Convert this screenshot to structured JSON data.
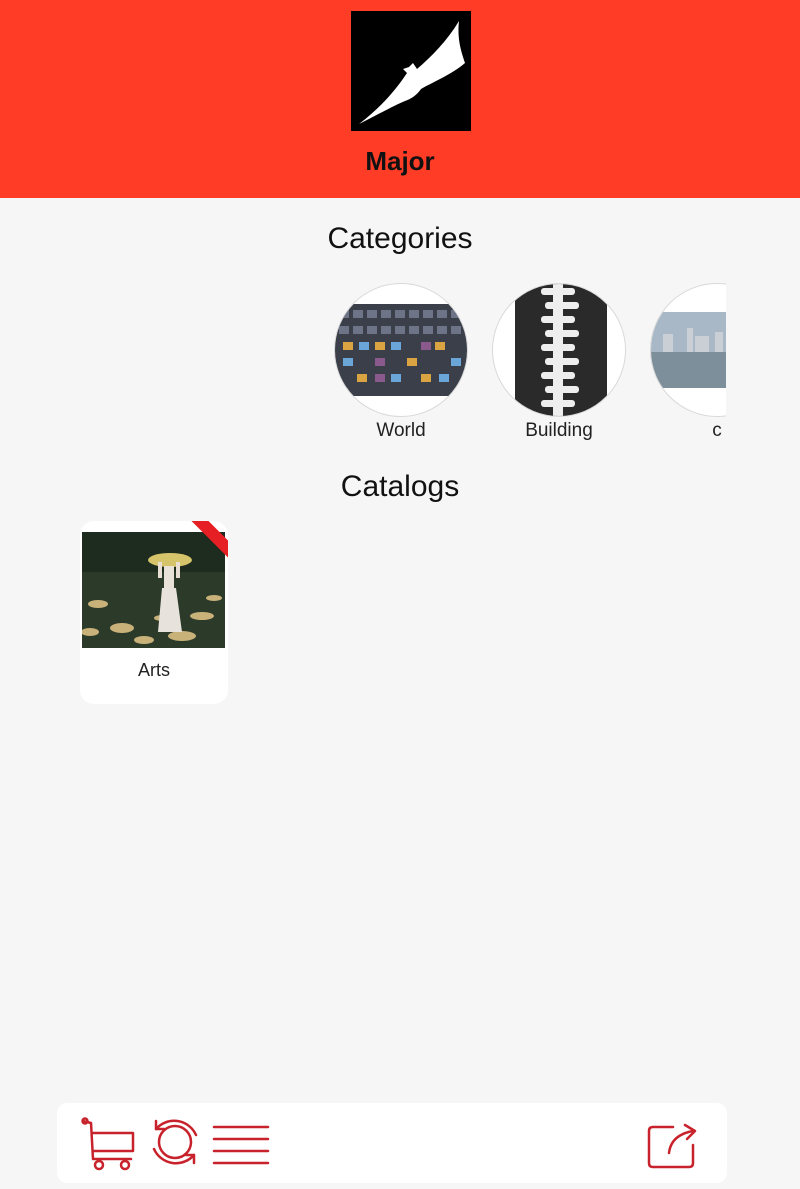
{
  "header": {
    "app_name": "Major",
    "logo_icon": "bat-logo-icon",
    "background_color": "#ff3d27"
  },
  "categories": {
    "title": "Categories",
    "items": [
      {
        "label": "World",
        "icon": "city-buildings-image"
      },
      {
        "label": "Building",
        "icon": "zipper-building-image"
      },
      {
        "label": "c",
        "icon": "city-skyline-image"
      }
    ]
  },
  "catalogs": {
    "title": "Catalogs",
    "items": [
      {
        "label": "Arts",
        "icon": "leaf-girl-image",
        "ribbon_color": "#e51f23"
      }
    ]
  },
  "bottom_bar": {
    "icon_color": "#c8232c",
    "left_icons": [
      "cart-icon",
      "refresh-icon",
      "menu-icon"
    ],
    "right_icons": [
      "share-icon"
    ]
  }
}
